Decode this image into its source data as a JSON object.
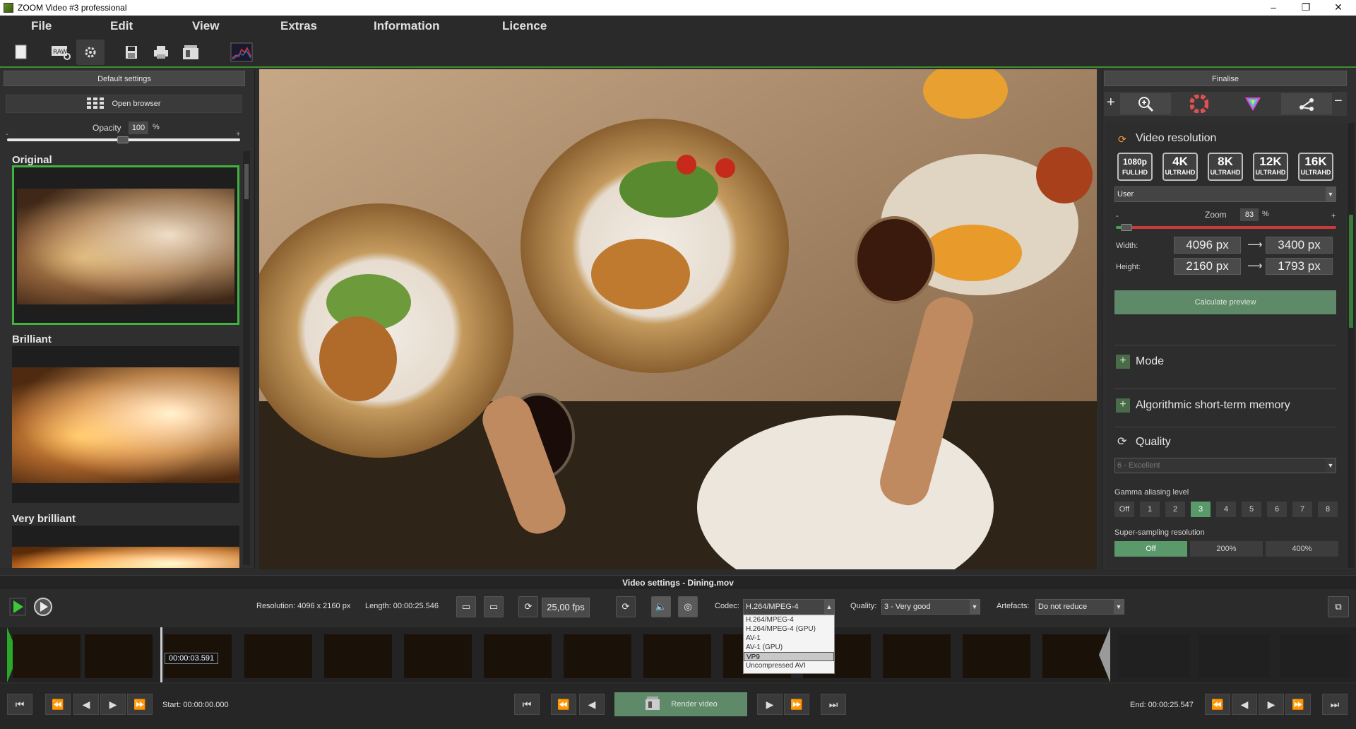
{
  "window": {
    "title": "ZOOM Video #3 professional",
    "minimize": "–",
    "maximize": "❐",
    "close": "✕"
  },
  "menu": [
    "File",
    "Edit",
    "View",
    "Extras",
    "Information",
    "Licence"
  ],
  "left": {
    "default_settings": "Default settings",
    "open_browser": "Open browser",
    "opacity_label": "Opacity",
    "opacity_value": "100",
    "opacity_unit": "%",
    "opacity_min": "-",
    "opacity_max": "+",
    "presets": [
      "Original",
      "Brilliant",
      "Very brilliant"
    ]
  },
  "right": {
    "finalise": "Finalise",
    "video_resolution": "Video resolution",
    "res_chips": [
      {
        "big": "1080p",
        "small": "FULLHD"
      },
      {
        "big": "4K",
        "small": "ULTRAHD"
      },
      {
        "big": "8K",
        "small": "ULTRAHD"
      },
      {
        "big": "12K",
        "small": "ULTRAHD"
      },
      {
        "big": "16K",
        "small": "ULTRAHD"
      }
    ],
    "user_select": "User",
    "zoom_label": "Zoom",
    "zoom_value": "83",
    "zoom_unit": "%",
    "zoom_min": "-",
    "zoom_max": "+",
    "width_label": "Width:",
    "width_from": "4096 px",
    "width_to": "3400 px",
    "height_label": "Height:",
    "height_from": "2160 px",
    "height_to": "1793 px",
    "arrow": "⟶",
    "calculate_preview": "Calculate preview",
    "mode": "Mode",
    "ast_memory": "Algorithmic short-term memory",
    "quality": "Quality",
    "quality_select": "6 - Excellent",
    "gamma_label": "Gamma aliasing level",
    "gamma_levels": [
      "Off",
      "1",
      "2",
      "3",
      "4",
      "5",
      "6",
      "7",
      "8"
    ],
    "gamma_selected": "3",
    "ss_label": "Super-sampling resolution",
    "ss_options": [
      "Off",
      "200%",
      "400%"
    ],
    "ss_selected": "Off"
  },
  "video": {
    "settings_title": "Video settings - Dining.mov",
    "resolution": "Resolution: 4096 x 2160 px",
    "length": "Length: 00:00:25.546",
    "fps": "25,00 fps",
    "codec_label": "Codec:",
    "codec_value": "H.264/MPEG-4",
    "codec_options": [
      "H.264/MPEG-4",
      "H.264/MPEG-4 (GPU)",
      "AV-1",
      "AV-1 (GPU)",
      "VP9",
      "Uncompressed AVI"
    ],
    "codec_highlighted": "VP9",
    "quality_label": "Quality:",
    "quality_value": "3 - Very good",
    "artefacts_label": "Artefacts:",
    "artefacts_value": "Do not reduce",
    "timestamp": "00:00:03.591",
    "start": "Start: 00:00:00.000",
    "end": "End: 00:00:25.547",
    "render": "Render video"
  },
  "colors": {
    "accent": "#3e8e2e",
    "panel": "#2f2f2f",
    "button_green": "#5a8a6a"
  }
}
